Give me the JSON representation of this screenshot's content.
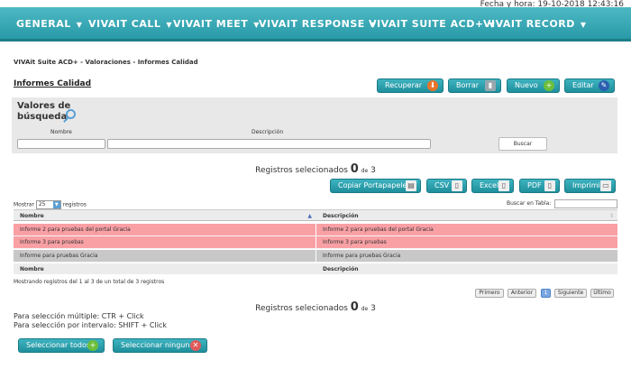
{
  "header": {
    "datetime": "Fecha y hora: 19-10-2018 12:43:16"
  },
  "nav": [
    {
      "label": "GENERAL",
      "caret": "▼"
    },
    {
      "label": "VIVAIT CALL",
      "caret": "▼"
    },
    {
      "label": "VIVAIT MEET",
      "caret": "▼"
    },
    {
      "label": "VIVAIT RESPONSE",
      "caret": "▼"
    },
    {
      "label": "VIVAIT SUITE ACD+",
      "caret": "▼"
    },
    {
      "label": "VIVAIT RECORD",
      "caret": "▼"
    }
  ],
  "breadcrumb": "VIVAit Suite ACD+ - Valoraciones - Informes Calidad",
  "page_title": "Informes Calidad",
  "toolbar": [
    {
      "label": "Recuperar",
      "icon": "download-icon",
      "glyph": "⬇",
      "color": "#e8742b"
    },
    {
      "label": "Borrar",
      "icon": "trash-icon",
      "glyph": "▮",
      "color": "#9aa6ad"
    },
    {
      "label": "Nuevo",
      "icon": "plus-icon",
      "glyph": "+",
      "color": "#6cbf3a"
    },
    {
      "label": "Editar",
      "icon": "edit-icon",
      "glyph": "✎",
      "color": "#2a5fb0"
    }
  ],
  "search": {
    "title": "Valores de búsqueda",
    "icon": "magnifier-icon",
    "col_nombre": "Nombre",
    "col_descripcion": "Descripción",
    "button": "Buscar"
  },
  "selection": {
    "prefix": "Registros selecionados",
    "selected": "0",
    "de": "de",
    "total": "3"
  },
  "export": [
    {
      "label": "Copiar Portapapeles",
      "icon": "clipboard-icon",
      "glyph": "▤"
    },
    {
      "label": "CSV",
      "icon": "csv-file-icon",
      "glyph": "▯"
    },
    {
      "label": "Excel",
      "icon": "excel-file-icon",
      "glyph": "▯"
    },
    {
      "label": "PDF",
      "icon": "pdf-file-icon",
      "glyph": "▯"
    },
    {
      "label": "Imprimir",
      "icon": "printer-icon",
      "glyph": "▭"
    }
  ],
  "table": {
    "mostrar": "Mostrar",
    "length": "25",
    "registros": "registros",
    "search_label": "Buscar en Tabla:",
    "columns": [
      "Nombre",
      "Descripción"
    ],
    "rows": [
      {
        "nombre": "Informe 2 para pruebas del portal Gracia",
        "descripcion": "Informe 2 para pruebas del portal Gracia",
        "color": "#f9a0a5"
      },
      {
        "nombre": "Informe 3 para pruebas",
        "descripcion": "Informe 3 para pruebas",
        "color": "#f9a0a5"
      },
      {
        "nombre": "Informe para pruebas Gracia",
        "descripcion": "Informe para pruebas Gracia",
        "color": "#c8c8c8"
      }
    ],
    "info": "Mostrando registros del 1 al 3 de un total de 3 registros"
  },
  "pagination": {
    "first": "Primero",
    "previous": "Anterior",
    "current": "1",
    "next": "Siguiente",
    "last": "Último"
  },
  "help": {
    "multiple": "Para selección múltiple: CTR + Click",
    "interval": "Para selección por intervalo: SHIFT + Click"
  },
  "bottom_buttons": [
    {
      "label": "Seleccionar todos",
      "icon": "plus-icon",
      "glyph": "+",
      "color": "#6cbf3a"
    },
    {
      "label": "Seleccionar ninguno",
      "icon": "x-icon",
      "glyph": "✕",
      "color": "#e05a5a"
    }
  ]
}
